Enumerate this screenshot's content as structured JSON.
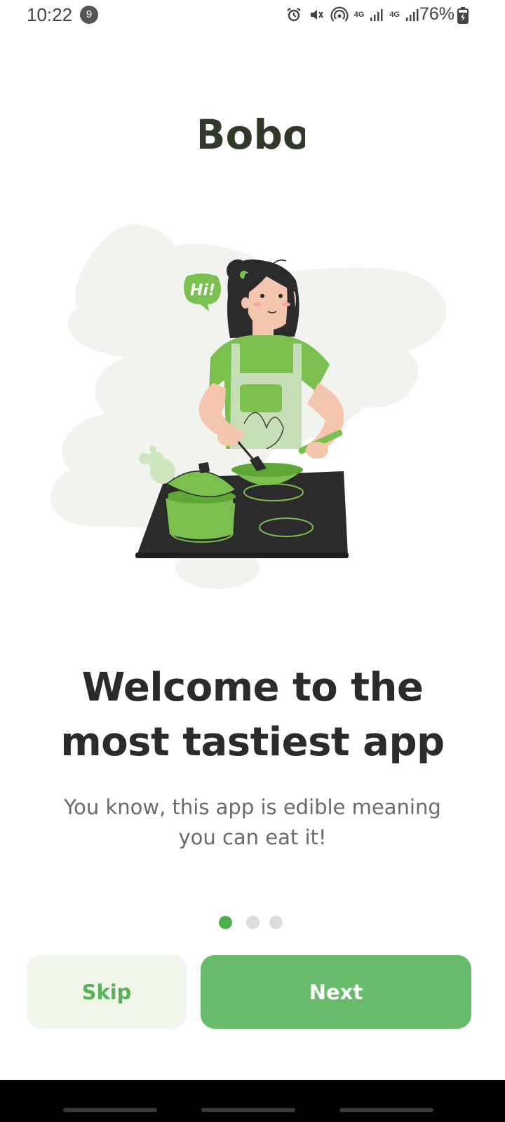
{
  "status_bar": {
    "time": "10:22",
    "notification_count": "9",
    "network_1": "4G",
    "network_2": "4G",
    "battery": "76%"
  },
  "brand": {
    "logo_text": "Bobo",
    "primary_color": "#67bb6b",
    "accent_color": "#4caf50"
  },
  "illustration": {
    "speech_bubble": "Hi!"
  },
  "onboarding": {
    "title": "Welcome to the most tastiest app",
    "subtitle": "You know, this app is edible meaning you can eat it!",
    "current_page": 1,
    "total_pages": 3
  },
  "actions": {
    "skip_label": "Skip",
    "next_label": "Next"
  }
}
